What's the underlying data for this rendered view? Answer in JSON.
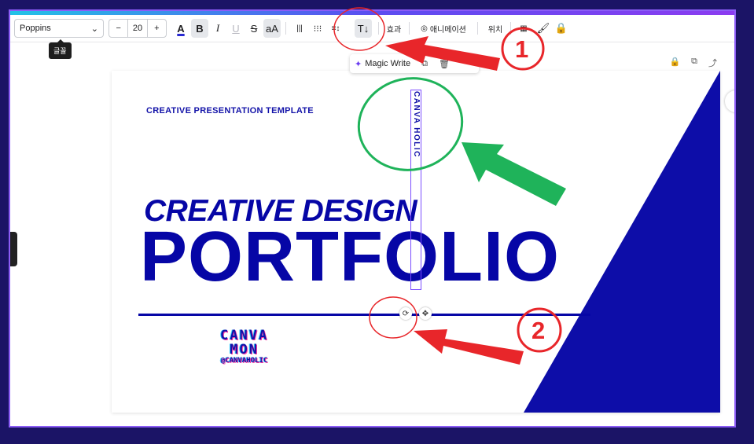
{
  "toolbar": {
    "font": "Poppins",
    "font_size": "20",
    "minus": "−",
    "plus": "+",
    "font_color_glyph": "A",
    "bold": "B",
    "italic": "I",
    "underline": "U",
    "strike": "S",
    "case": "aA",
    "align_glyph": "|||",
    "list_glyph": "⁝⁝⁝",
    "spacing_glyph": "≡↕",
    "vertical_text_glyph": "T↓",
    "effects": "효과",
    "animate": "애니메이션",
    "position": "위치",
    "tooltip": "글꼴"
  },
  "magic": {
    "label": "Magic Write"
  },
  "slide": {
    "subtitle": "CREATIVE PRESENTATION TEMPLATE",
    "line1": "CREATIVE DESIGN",
    "line2": "PORTFOLIO",
    "vertical": "CANVA HOLIC",
    "logo_line1": "CANVA",
    "logo_line2": "MON",
    "logo_handle": "@CANVAHOLIC"
  },
  "annotations": {
    "num1": "1",
    "num2": "2"
  },
  "colors": {
    "brand_blue": "#0606a6",
    "arrow_red": "#e8262a",
    "arrow_green": "#1fb35a",
    "background": "#1b1466"
  }
}
